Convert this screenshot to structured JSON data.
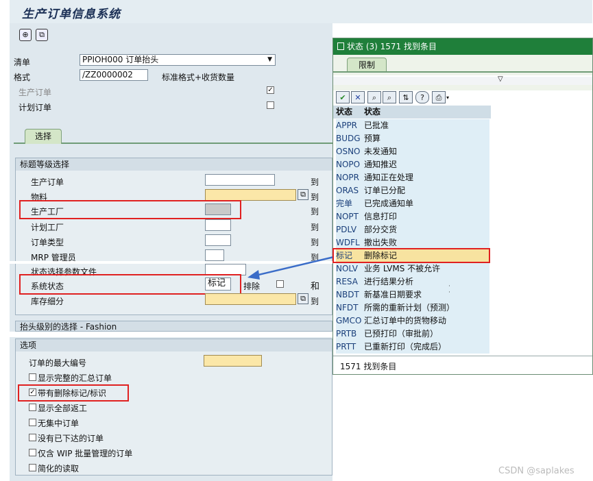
{
  "app": {
    "title": "生产订单信息系统"
  },
  "toolbar": {
    "execute_icon": "⊕",
    "variant_icon": "⧉"
  },
  "header": {
    "list_label": "清单",
    "list_value": "PPIOH000 订单抬头",
    "format_label": "格式",
    "format_value": "/ZZ0000002",
    "format_desc": "标准格式+收货数量",
    "prod_order_label": "生产订单",
    "planned_order_label": "计划订单"
  },
  "tabs": {
    "selection": "选择"
  },
  "selection_group": {
    "title": "标题等级选择",
    "rows": [
      {
        "label": "生产订单",
        "value": "",
        "to": "到"
      },
      {
        "label": "物料",
        "value": "",
        "to": "到"
      },
      {
        "label": "生产工厂",
        "value": "",
        "to": "到"
      },
      {
        "label": "计划工厂",
        "value": "",
        "to": "到"
      },
      {
        "label": "订单类型",
        "value": "",
        "to": "到"
      },
      {
        "label": "MRP 管理员",
        "value": "",
        "to": "到"
      },
      {
        "label": "状态选择参数文件",
        "value": "",
        "to": ""
      },
      {
        "label": "系统状态",
        "value": "标记",
        "to": "和"
      },
      {
        "label": "库存细分",
        "value": "",
        "to": "到"
      }
    ],
    "exclude_label": "排除"
  },
  "fashion_group": {
    "title": "抬头级别的选择 - Fashion"
  },
  "options_group": {
    "title": "选项",
    "max_orders_label": "订单的最大编号",
    "checkboxes": [
      {
        "label": "显示完整的汇总订单",
        "checked": false
      },
      {
        "label": "带有删除标记/标识",
        "checked": true
      },
      {
        "label": "显示全部返工",
        "checked": false
      },
      {
        "label": "无集中订单",
        "checked": false
      },
      {
        "label": "没有已下达的订单",
        "checked": false
      },
      {
        "label": "仅含 WIP 批量管理的订单",
        "checked": false
      },
      {
        "label": "简化的读取",
        "checked": false
      }
    ]
  },
  "popup": {
    "title": "状态 (3) 1571 找到条目",
    "tab": "限制",
    "col_code": "状态",
    "col_desc": "状态",
    "rows": [
      {
        "code": "APPR",
        "desc": "已批准"
      },
      {
        "code": "BUDG",
        "desc": "预算"
      },
      {
        "code": "OSNO",
        "desc": "未发通知"
      },
      {
        "code": "NOPO",
        "desc": "通知推迟"
      },
      {
        "code": "NOPR",
        "desc": "通知正在处理"
      },
      {
        "code": "ORAS",
        "desc": "订单已分配"
      },
      {
        "code": "完单",
        "desc": "已完成通知单"
      },
      {
        "code": "NOPT",
        "desc": "信息打印"
      },
      {
        "code": "PDLV",
        "desc": "部分交货"
      },
      {
        "code": "WDFL",
        "desc": "撤出失败"
      },
      {
        "code": "标记",
        "desc": "删除标记"
      },
      {
        "code": "NOLV",
        "desc": "业务 LVMS 不被允许"
      },
      {
        "code": "RESA",
        "desc": "进行结果分析"
      },
      {
        "code": "NBDT",
        "desc": "新基准日期要求"
      },
      {
        "code": "NFDT",
        "desc": "所需的重新计划（预测）"
      },
      {
        "code": "GMCO",
        "desc": "汇总订单中的货物移动"
      },
      {
        "code": "PRTB",
        "desc": "已预打印（审批前）"
      },
      {
        "code": "PRTT",
        "desc": "已重新打印（完成后）"
      }
    ],
    "footer": "1571 找到条目"
  },
  "watermark": "CSDN @saplakes"
}
